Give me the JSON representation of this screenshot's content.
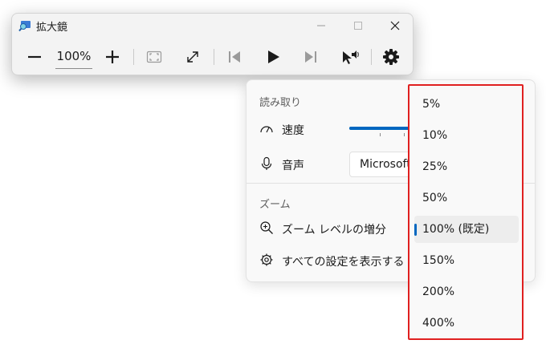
{
  "window": {
    "title": "拡大鏡",
    "zoom_value": "100%"
  },
  "flyout": {
    "reading_section": "読み取り",
    "speed_label": "速度",
    "speed_level_percent": 55,
    "voice_label": "音声",
    "voice_value": "Microsoft",
    "zoom_section": "ズーム",
    "zoom_increment_label": "ズーム レベルの増分",
    "all_settings_label": "すべての設定を表示する"
  },
  "dropdown": {
    "options": [
      "5%",
      "10%",
      "25%",
      "50%",
      "100% (既定)",
      "150%",
      "200%",
      "400%"
    ],
    "selected_index": 4
  },
  "colors": {
    "accent": "#0067c0",
    "highlight_border": "#e02020"
  }
}
